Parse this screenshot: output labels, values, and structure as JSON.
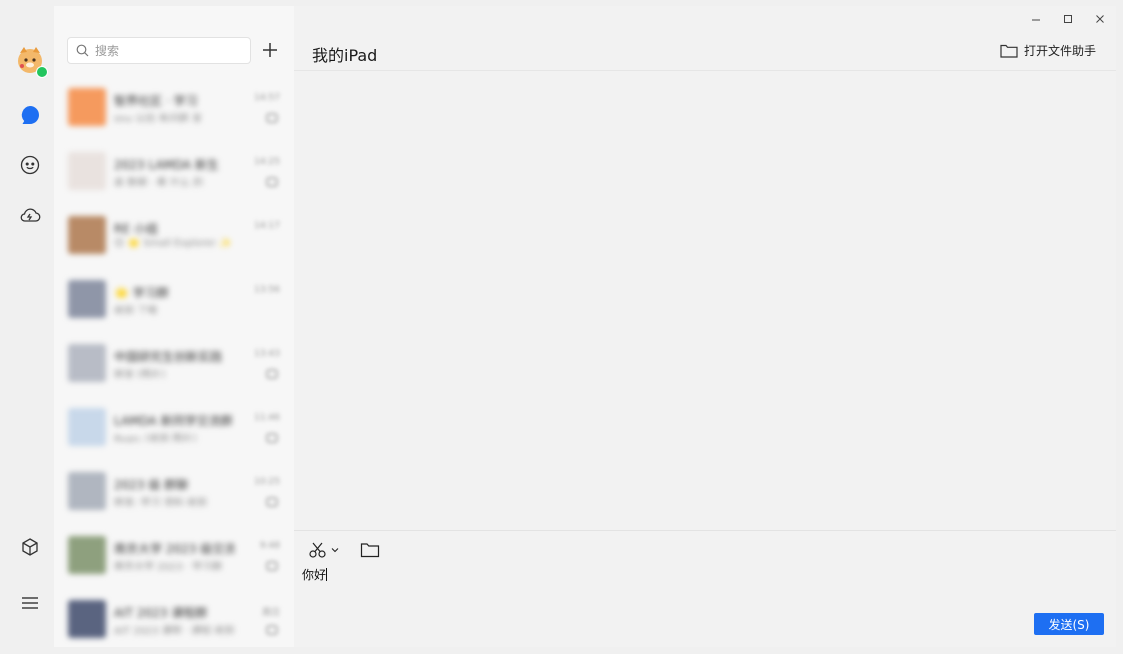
{
  "search": {
    "placeholder": "搜索"
  },
  "chat": {
    "title": "我的iPad",
    "open_assistant_label": "打开文件助手",
    "input_text": "你好",
    "send_label": "发送(S)"
  },
  "conversations": [
    {
      "name": "智界社区 · 学习",
      "snippet": "imy 以后 有问题 发",
      "time": "14:57",
      "thumb_color": "#f59a5e",
      "muted": true
    },
    {
      "name": "2023 LAMDA 新生",
      "snippet": "高 数据 · 看 什么 的",
      "time": "14:25",
      "thumb_color": "#e9e2df",
      "muted": true
    },
    {
      "name": "RE 小组",
      "snippet": "😊 🌟 Small Explorer ✨",
      "time": "14:17",
      "thumb_color": "#b88a66",
      "muted": false
    },
    {
      "name": "🌟 学习群",
      "snippet": "收到 了哦",
      "time": "13:56",
      "thumb_color": "#8f96a8",
      "muted": false
    },
    {
      "name": "中国研究生创新实践",
      "snippet": "转发 [图片]",
      "time": "13:43",
      "thumb_color": "#b8bcc6",
      "muted": true
    },
    {
      "name": "LAMDA 新同学交流群",
      "snippet": "Ryan: [收到 图片]",
      "time": "11:46",
      "thumb_color": "#c8d8ea",
      "muted": true
    },
    {
      "name": "2023 级 群聊",
      "snippet": "转发: 学习 资料 收到",
      "time": "10:25",
      "thumb_color": "#b0b6c0",
      "muted": true
    },
    {
      "name": "南京大学 2023 级交流",
      "snippet": "南京大学 2023 · 学习群",
      "time": "9:48",
      "thumb_color": "#8ea07e",
      "muted": true
    },
    {
      "name": "AIT 2023 课程群",
      "snippet": "AIT 2023 课程 · 通知 收到",
      "time": "周日",
      "thumb_color": "#5a6480",
      "muted": true
    }
  ],
  "colors": {
    "accent": "#1e6ff2",
    "online": "#22c55e"
  }
}
